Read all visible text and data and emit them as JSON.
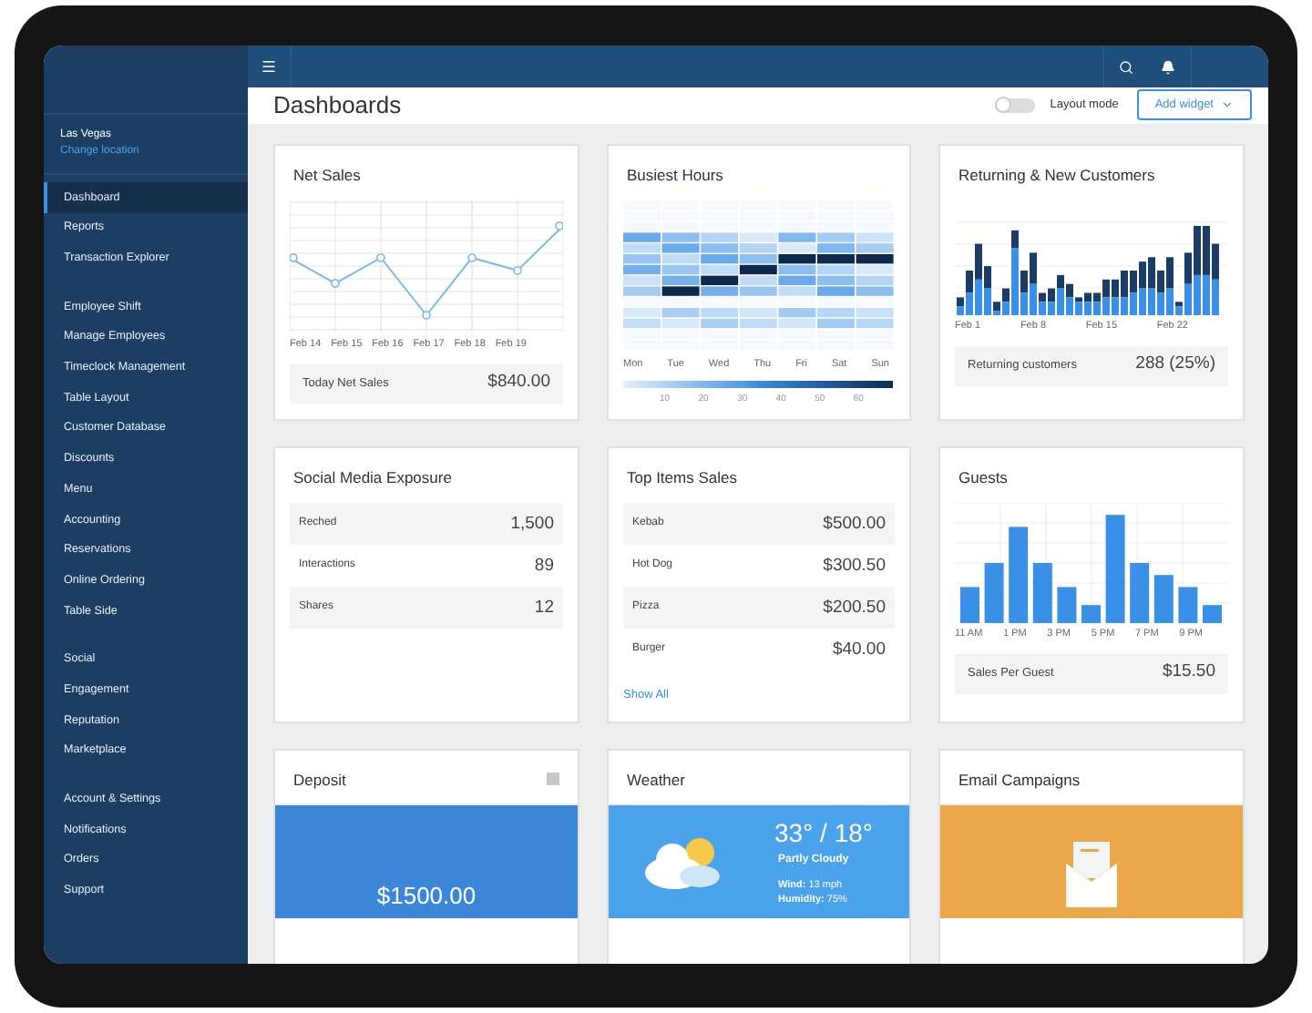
{
  "sidebar": {
    "location": "Las Vegas",
    "change_location": "Change location",
    "sections": [
      {
        "items": [
          {
            "label": "Dashboard",
            "selected": true
          },
          {
            "label": "Reports",
            "selected": false
          },
          {
            "label": "Transaction Explorer",
            "selected": false
          }
        ]
      },
      {
        "items": [
          {
            "label": "Employee Shift",
            "selected": false
          },
          {
            "label": "Manage Employees",
            "selected": false
          },
          {
            "label": "Timeclock Management",
            "selected": false
          },
          {
            "label": "Table Layout",
            "selected": false
          },
          {
            "label": "Customer Database",
            "selected": false
          },
          {
            "label": "Discounts",
            "selected": false
          },
          {
            "label": "Menu",
            "selected": false
          },
          {
            "label": "Accounting",
            "selected": false
          },
          {
            "label": "Reservations",
            "selected": false
          },
          {
            "label": "Online Ordering",
            "selected": false
          },
          {
            "label": "Table Side",
            "selected": false
          }
        ]
      },
      {
        "items": [
          {
            "label": "Social",
            "selected": false
          },
          {
            "label": "Engagement",
            "selected": false
          },
          {
            "label": "Reputation",
            "selected": false
          },
          {
            "label": "Marketplace",
            "selected": false
          }
        ]
      },
      {
        "items": [
          {
            "label": "Account & Settings",
            "selected": false
          },
          {
            "label": "Notifications",
            "selected": false
          },
          {
            "label": "Orders",
            "selected": false
          },
          {
            "label": "Support",
            "selected": false
          }
        ]
      }
    ]
  },
  "header": {
    "title": "Dashboards",
    "layout_toggle": {
      "label": "Layout mode",
      "on": false
    },
    "add_button": "Add widget"
  },
  "widgets": [
    {
      "kind": "line",
      "title": "Net Sales",
      "x_labels": [
        "Feb 14",
        "Feb 15",
        "Feb 16",
        "Feb 17",
        "Feb 18",
        "Feb 19"
      ],
      "footer_label": "Today Net Sales",
      "footer_value": "$840.00"
    },
    {
      "kind": "heatmap",
      "title": "Busiest Hours",
      "days": [
        "Mon",
        "Tue",
        "Wed",
        "Thu",
        "Fri",
        "Sat",
        "Sun"
      ],
      "scale_labels": [
        "10",
        "20",
        "30",
        "40",
        "50",
        "60"
      ]
    },
    {
      "kind": "stacked",
      "title": "Returning & New Customers",
      "x_labels": [
        "Feb 1",
        "Feb 8",
        "Feb 15",
        "Feb 22"
      ],
      "footer_label": "Returning customers",
      "footer_value": "288 (25%)"
    },
    {
      "kind": "list",
      "title": "Social Media Exposure",
      "rows": [
        {
          "label": "Reched",
          "value": "1,500"
        },
        {
          "label": "Interactions",
          "value": "89"
        },
        {
          "label": "Shares",
          "value": "12"
        }
      ]
    },
    {
      "kind": "list",
      "title": "Top Items Sales",
      "rows": [
        {
          "label": "Kebab",
          "value": "$500.00"
        },
        {
          "label": "Hot Dog",
          "value": "$300.50"
        },
        {
          "label": "Pizza",
          "value": "$200.50"
        },
        {
          "label": "Burger",
          "value": "$40.00"
        }
      ],
      "link": "Show All"
    },
    {
      "kind": "bars",
      "title": "Guests",
      "x_labels": [
        "11 AM",
        "1 PM",
        "3 PM",
        "5 PM",
        "7 PM",
        "9 PM"
      ],
      "footer_label": "Sales Per Guest",
      "footer_value": "$15.50"
    },
    {
      "kind": "deposit",
      "title": "Deposit",
      "amount": "$1500.00"
    },
    {
      "kind": "weather",
      "title": "Weather",
      "temperature": "33° / 18°",
      "condition": "Partly Cloudy",
      "wind": "**Wind:** 13 mph",
      "humidity": "**Humidity:** 75%"
    },
    {
      "kind": "email",
      "title": "Email Campaigns"
    }
  ]
}
